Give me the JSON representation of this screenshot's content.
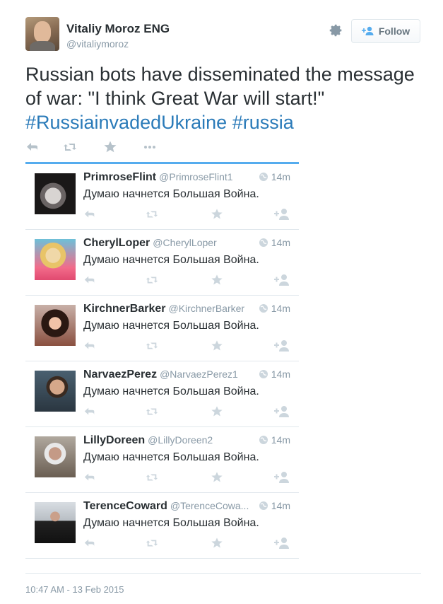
{
  "author": {
    "name": "Vitaliy Moroz ENG",
    "handle": "@vitaliymoroz"
  },
  "follow_label": "Follow",
  "tweet": {
    "text_plain": "Russian bots have disseminated the message of war: \"I think Great War will start!\"",
    "hashtag1": "#RussiainvadedUkraine",
    "hashtag2": "#russia"
  },
  "icons": {
    "settings": "gear-icon",
    "reply": "reply-icon",
    "retweet": "retweet-icon",
    "favorite": "star-icon",
    "more": "more-icon",
    "follow": "add-user-icon",
    "globe": "globe-icon"
  },
  "colors": {
    "hashtag": "#2b7bb9",
    "accent": "#55acee",
    "muted": "#8899a6"
  },
  "replies": [
    {
      "name": "PrimroseFlint",
      "handle": "@PrimroseFlint1",
      "time": "14m",
      "text": "Думаю начнется Большая Война."
    },
    {
      "name": "CherylLoper",
      "handle": "@CherylLoper",
      "time": "14m",
      "text": "Думаю начнется Большая Война."
    },
    {
      "name": "KirchnerBarker",
      "handle": "@KirchnerBarker",
      "time": "14m",
      "text": "Думаю начнется Большая Война."
    },
    {
      "name": "NarvaezPerez",
      "handle": "@NarvaezPerez1",
      "time": "14m",
      "text": "Думаю начнется Большая Война."
    },
    {
      "name": "LillyDoreen",
      "handle": "@LillyDoreen2",
      "time": "14m",
      "text": "Думаю начнется Большая Война."
    },
    {
      "name": "TerenceCoward",
      "handle": "@TerenceCowa...",
      "time": "14m",
      "text": "Думаю начнется Большая Война."
    }
  ],
  "timestamp": "10:47 AM - 13 Feb 2015"
}
